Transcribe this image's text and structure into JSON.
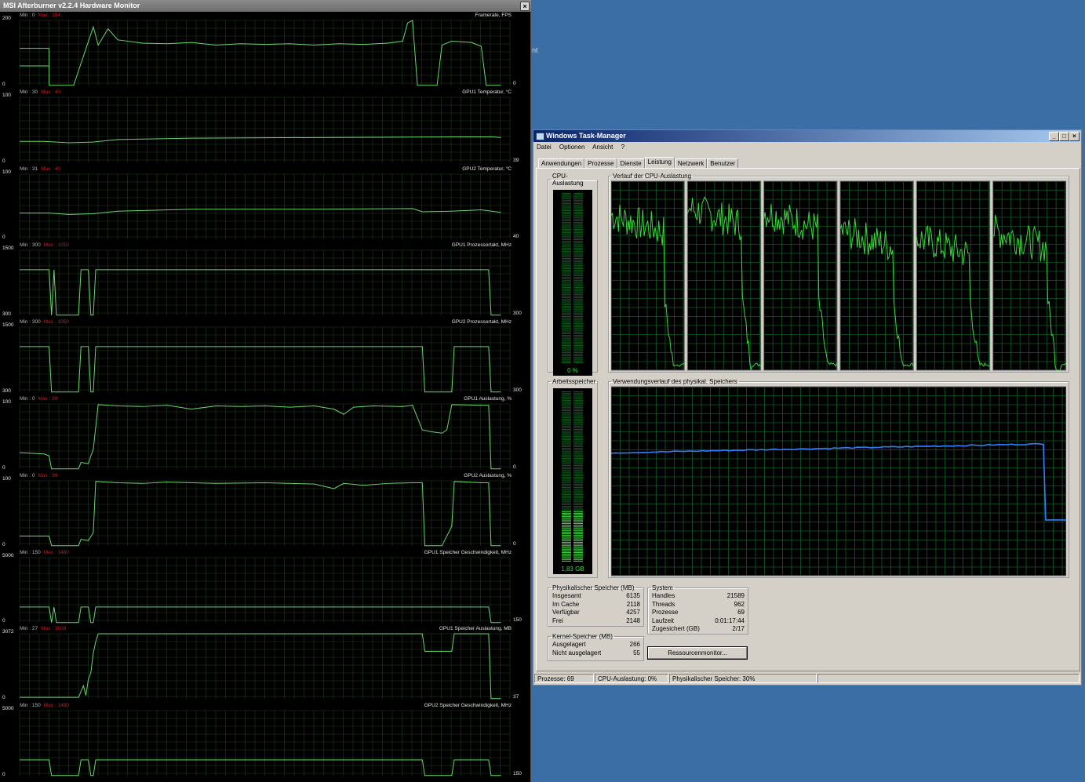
{
  "desktop": {
    "fragment": "nt"
  },
  "afterburner": {
    "title": "MSI Afterburner v2.2.4 Hardware Monitor",
    "close_glyph": "×",
    "panels": [
      {
        "name": "Framerate, FPS",
        "min": "Min : 0",
        "max": "Max : 154",
        "top": "200",
        "bottom": "0",
        "current": "0",
        "trace": [
          [
            0,
            57
          ],
          [
            6,
            57
          ],
          [
            6,
            0
          ],
          [
            11,
            0
          ],
          [
            15,
            90
          ],
          [
            16,
            62
          ],
          [
            18,
            87
          ],
          [
            20,
            70
          ],
          [
            25,
            65
          ],
          [
            30,
            64
          ],
          [
            35,
            66
          ],
          [
            40,
            62
          ],
          [
            45,
            64
          ],
          [
            50,
            63
          ],
          [
            55,
            64
          ],
          [
            60,
            62
          ],
          [
            65,
            64
          ],
          [
            70,
            63
          ],
          [
            75,
            65
          ],
          [
            78,
            68
          ],
          [
            79,
            96
          ],
          [
            80,
            100
          ],
          [
            81,
            0
          ],
          [
            85,
            0
          ],
          [
            86,
            62
          ],
          [
            88,
            68
          ],
          [
            92,
            66
          ],
          [
            94,
            60
          ],
          [
            95,
            0
          ],
          [
            98,
            0
          ]
        ],
        "segments": [
          [
            [
              0,
              30
            ],
            [
              6,
              30
            ]
          ]
        ]
      },
      {
        "name": "GPU1 Temperatur, °C",
        "min": "Min : 30",
        "max": "Max : 40",
        "top": "100",
        "bottom": "0",
        "current": "39",
        "trace": [
          [
            0,
            32
          ],
          [
            5,
            32
          ],
          [
            10,
            30
          ],
          [
            15,
            31
          ],
          [
            20,
            35
          ],
          [
            35,
            37
          ],
          [
            60,
            38
          ],
          [
            90,
            39
          ],
          [
            96,
            39
          ],
          [
            98,
            38
          ]
        ]
      },
      {
        "name": "GPU2 Temperatur, °C",
        "min": "Min : 31",
        "max": "Max : 40",
        "top": "100",
        "bottom": "0",
        "current": "40",
        "trace": [
          [
            0,
            40
          ],
          [
            6,
            40
          ],
          [
            10,
            38
          ],
          [
            15,
            39
          ],
          [
            20,
            43
          ],
          [
            35,
            46
          ],
          [
            60,
            46
          ],
          [
            80,
            47
          ],
          [
            82,
            42
          ],
          [
            88,
            43
          ],
          [
            94,
            45
          ],
          [
            98,
            41
          ]
        ]
      },
      {
        "name": "GPU1 Prozessortakt, MHz",
        "min": "Min : 300",
        "max": "Max : 1050",
        "top": "1500",
        "bottom": "300",
        "current": "300",
        "trace": [
          [
            0,
            70
          ],
          [
            6,
            70
          ],
          [
            6.5,
            0
          ],
          [
            7,
            70
          ],
          [
            7.5,
            0
          ],
          [
            12,
            0
          ],
          [
            12.5,
            70
          ],
          [
            14,
            70
          ],
          [
            14.5,
            0
          ],
          [
            15,
            0
          ],
          [
            15.5,
            70
          ],
          [
            95.5,
            70
          ],
          [
            96,
            0
          ],
          [
            98,
            0
          ]
        ]
      },
      {
        "name": "GPU2 Prozessortakt, MHz",
        "min": "Min : 300",
        "max": "Max : 1050",
        "top": "1500",
        "bottom": "300",
        "current": "300",
        "trace": [
          [
            0,
            70
          ],
          [
            6,
            70
          ],
          [
            6.5,
            0
          ],
          [
            12,
            0
          ],
          [
            12.5,
            70
          ],
          [
            14,
            70
          ],
          [
            14.5,
            0
          ],
          [
            15,
            0
          ],
          [
            15.5,
            70
          ],
          [
            82,
            70
          ],
          [
            82.5,
            0
          ],
          [
            88,
            0
          ],
          [
            88.5,
            70
          ],
          [
            95.5,
            70
          ],
          [
            96,
            0
          ],
          [
            98,
            0
          ]
        ]
      },
      {
        "name": "GPU1 Auslastung, %",
        "min": "Min : 0",
        "max": "Max : 99",
        "top": "100",
        "bottom": "0",
        "current": "0",
        "trace": [
          [
            0,
            25
          ],
          [
            5,
            23
          ],
          [
            6,
            20
          ],
          [
            6.5,
            0
          ],
          [
            12,
            0
          ],
          [
            12.5,
            10
          ],
          [
            14,
            8
          ],
          [
            14.5,
            20
          ],
          [
            15,
            30
          ],
          [
            16,
            99
          ],
          [
            20,
            97
          ],
          [
            25,
            96
          ],
          [
            30,
            98
          ],
          [
            35,
            92
          ],
          [
            40,
            97
          ],
          [
            45,
            96
          ],
          [
            50,
            97
          ],
          [
            55,
            95
          ],
          [
            60,
            97
          ],
          [
            64,
            92
          ],
          [
            66,
            84
          ],
          [
            68,
            95
          ],
          [
            72,
            97
          ],
          [
            78,
            96
          ],
          [
            80,
            98
          ],
          [
            82,
            60
          ],
          [
            84,
            57
          ],
          [
            86,
            55
          ],
          [
            87,
            60
          ],
          [
            88,
            99
          ],
          [
            94,
            98
          ],
          [
            95.5,
            98
          ],
          [
            96,
            0
          ],
          [
            98,
            0
          ]
        ]
      },
      {
        "name": "GPU2 Auslastung, %",
        "min": "Min : 0",
        "max": "Max : 99",
        "top": "100",
        "bottom": "0",
        "current": "0",
        "trace": [
          [
            0,
            15
          ],
          [
            6,
            15
          ],
          [
            6.5,
            0
          ],
          [
            12,
            0
          ],
          [
            12.5,
            10
          ],
          [
            14,
            8
          ],
          [
            15,
            20
          ],
          [
            15.5,
            99
          ],
          [
            20,
            97
          ],
          [
            25,
            96
          ],
          [
            30,
            98
          ],
          [
            40,
            96
          ],
          [
            50,
            97
          ],
          [
            60,
            95
          ],
          [
            64,
            88
          ],
          [
            66,
            96
          ],
          [
            70,
            93
          ],
          [
            75,
            96
          ],
          [
            80,
            97
          ],
          [
            82,
            97
          ],
          [
            82.5,
            0
          ],
          [
            86,
            0
          ],
          [
            88,
            30
          ],
          [
            88.5,
            99
          ],
          [
            94,
            97
          ],
          [
            95.5,
            97
          ],
          [
            96,
            0
          ],
          [
            98,
            0
          ]
        ]
      },
      {
        "name": "GPU1 Speicher Geschwindigkeit, MHz",
        "min": "Min : 150",
        "max": "Max : 1480",
        "top": "5000",
        "bottom": "0",
        "current": "150",
        "trace": [
          [
            0,
            24
          ],
          [
            6,
            24
          ],
          [
            6.5,
            0
          ],
          [
            7,
            24
          ],
          [
            7.5,
            0
          ],
          [
            12,
            0
          ],
          [
            12.5,
            24
          ],
          [
            14,
            24
          ],
          [
            14.5,
            0
          ],
          [
            15,
            0
          ],
          [
            15.5,
            24
          ],
          [
            95.5,
            24
          ],
          [
            96,
            0
          ],
          [
            98,
            0
          ]
        ]
      },
      {
        "name": "GPU1 Speicher Auslastung, MB",
        "min": "Min : 27",
        "max": "Max : 3608",
        "top": "3072",
        "bottom": "0",
        "current": "37",
        "trace": [
          [
            0,
            2
          ],
          [
            12,
            2
          ],
          [
            13,
            20
          ],
          [
            13.5,
            5
          ],
          [
            14,
            30
          ],
          [
            14.5,
            40
          ],
          [
            15,
            70
          ],
          [
            15.5,
            88
          ],
          [
            16,
            100
          ],
          [
            82,
            100
          ],
          [
            82.5,
            73
          ],
          [
            88,
            73
          ],
          [
            88.5,
            100
          ],
          [
            95.5,
            100
          ],
          [
            96,
            0
          ],
          [
            98,
            0
          ]
        ]
      },
      {
        "name": "GPU2 Speicher Geschwindigkeit, MHz",
        "min": "Min : 150",
        "max": "Max : 1480",
        "top": "5000",
        "bottom": "0",
        "current": "150",
        "trace": [
          [
            0,
            24
          ],
          [
            6,
            24
          ],
          [
            6.5,
            0
          ],
          [
            12,
            0
          ],
          [
            12.5,
            24
          ],
          [
            14,
            24
          ],
          [
            14.5,
            0
          ],
          [
            15,
            0
          ],
          [
            15.5,
            24
          ],
          [
            82,
            24
          ],
          [
            82.5,
            0
          ],
          [
            88,
            0
          ],
          [
            88.5,
            24
          ],
          [
            95.5,
            24
          ],
          [
            96,
            0
          ],
          [
            98,
            0
          ]
        ]
      }
    ]
  },
  "taskmanager": {
    "title": "Windows Task-Manager",
    "caption_min": "_",
    "caption_max": "□",
    "caption_close": "×",
    "menu": [
      "Datei",
      "Optionen",
      "Ansicht",
      "?"
    ],
    "tabs": [
      "Anwendungen",
      "Prozesse",
      "Dienste",
      "Leistung",
      "Netzwerk",
      "Benutzer"
    ],
    "active_tab": "Leistung",
    "cpu_usage_label": "CPU-Auslastung",
    "cpu_usage_value": "0 %",
    "cpu_usage_fraction": 0.0,
    "cpu_history_label": "Verlauf der CPU-Auslastung",
    "cpu_cores": 6,
    "mem_label": "Arbeitsspeicher",
    "mem_value": "1,83 GB",
    "mem_fraction": 0.3,
    "mem_history_label": "Verwendungsverlauf des physikal. Speichers",
    "physical": {
      "title": "Physikalischer Speicher (MB)",
      "rows": [
        {
          "label": "Insgesamt",
          "value": "6135"
        },
        {
          "label": "Im Cache",
          "value": "2118"
        },
        {
          "label": "Verfügbar",
          "value": "4257"
        },
        {
          "label": "Frei",
          "value": "2148"
        }
      ]
    },
    "system": {
      "title": "System",
      "rows": [
        {
          "label": "Handles",
          "value": "21589"
        },
        {
          "label": "Threads",
          "value": "962"
        },
        {
          "label": "Prozesse",
          "value": "69"
        },
        {
          "label": "Laufzeit",
          "value": "0:01:17:44"
        },
        {
          "label": "Zugesichert (GB)",
          "value": "2/17"
        }
      ]
    },
    "kernel": {
      "title": "Kernel-Speicher (MB)",
      "rows": [
        {
          "label": "Ausgelagert",
          "value": "266"
        },
        {
          "label": "Nicht ausgelagert",
          "value": "55"
        }
      ]
    },
    "resource_button": "Ressourcenmonitor...",
    "status": [
      "Prozesse: 69",
      "CPU-Auslastung: 0%",
      "Physikalischer Speicher: 30%"
    ],
    "colors": {
      "graph_green": "#3cd63c",
      "grid_green": "#0f5a28",
      "mem_line": "#2f7fff",
      "ab_trace": "#6bd66b",
      "ab_grid": "#1f3f1f"
    }
  }
}
